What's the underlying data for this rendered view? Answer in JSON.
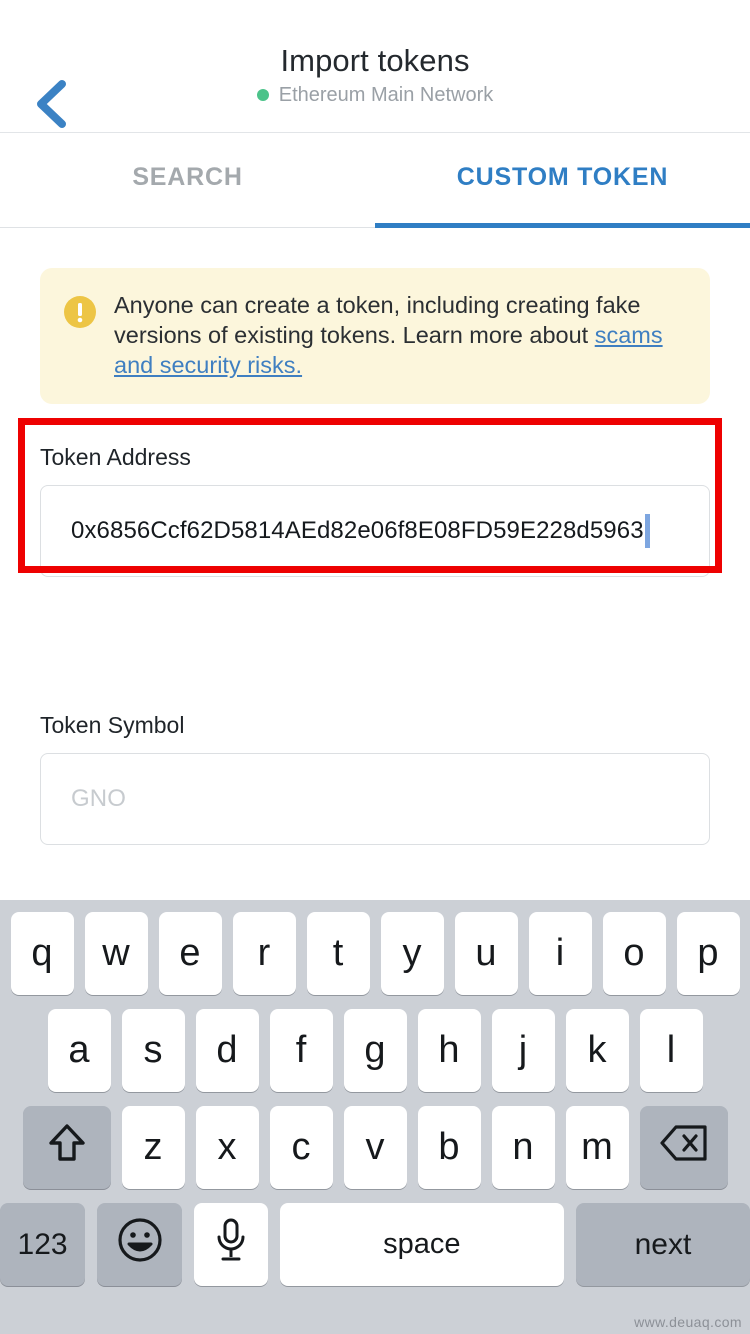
{
  "header": {
    "back_icon": "chevron-left-icon",
    "title": "Import tokens",
    "network": "Ethereum Main Network",
    "network_dot_color": "#4cc38a",
    "accent_color": "#3b82c4"
  },
  "tabs": [
    {
      "label": "SEARCH",
      "active": false
    },
    {
      "label": "CUSTOM TOKEN",
      "active": true
    }
  ],
  "warning": {
    "icon": "exclamation-circle-icon",
    "icon_color": "#edc545",
    "background": "#fcf6dc",
    "text": "Anyone can create a token, including creating fake versions of existing tokens. Learn more about ",
    "link_text": "scams and security risks.",
    "link_color": "#3f7fc1"
  },
  "annotation": {
    "highlight_color": "#ee0101",
    "target": "token-address-field"
  },
  "form": {
    "token_address": {
      "label": "Token Address",
      "value": "0x6856Ccf62D5814AEd82e06f8E08FD59E228d5963",
      "placeholder": "",
      "focused": true
    },
    "token_symbol": {
      "label": "Token Symbol",
      "value": "",
      "placeholder": "GNO",
      "focused": false
    }
  },
  "keyboard": {
    "row1": [
      "q",
      "w",
      "e",
      "r",
      "t",
      "y",
      "u",
      "i",
      "o",
      "p"
    ],
    "row2": [
      "a",
      "s",
      "d",
      "f",
      "g",
      "h",
      "j",
      "k",
      "l"
    ],
    "row3": [
      "z",
      "x",
      "c",
      "v",
      "b",
      "n",
      "m"
    ],
    "shift_icon": "shift-arrow-icon",
    "backspace_icon": "backspace-icon",
    "numbers_label": "123",
    "emoji_icon": "smiley-face-icon",
    "mic_icon": "microphone-icon",
    "space_label": "space",
    "next_label": "next",
    "background": "#ccd0d6",
    "key_color": "#ffffff",
    "mod_key_color": "#aeb4bd"
  },
  "watermark": "www.deuaq.com"
}
